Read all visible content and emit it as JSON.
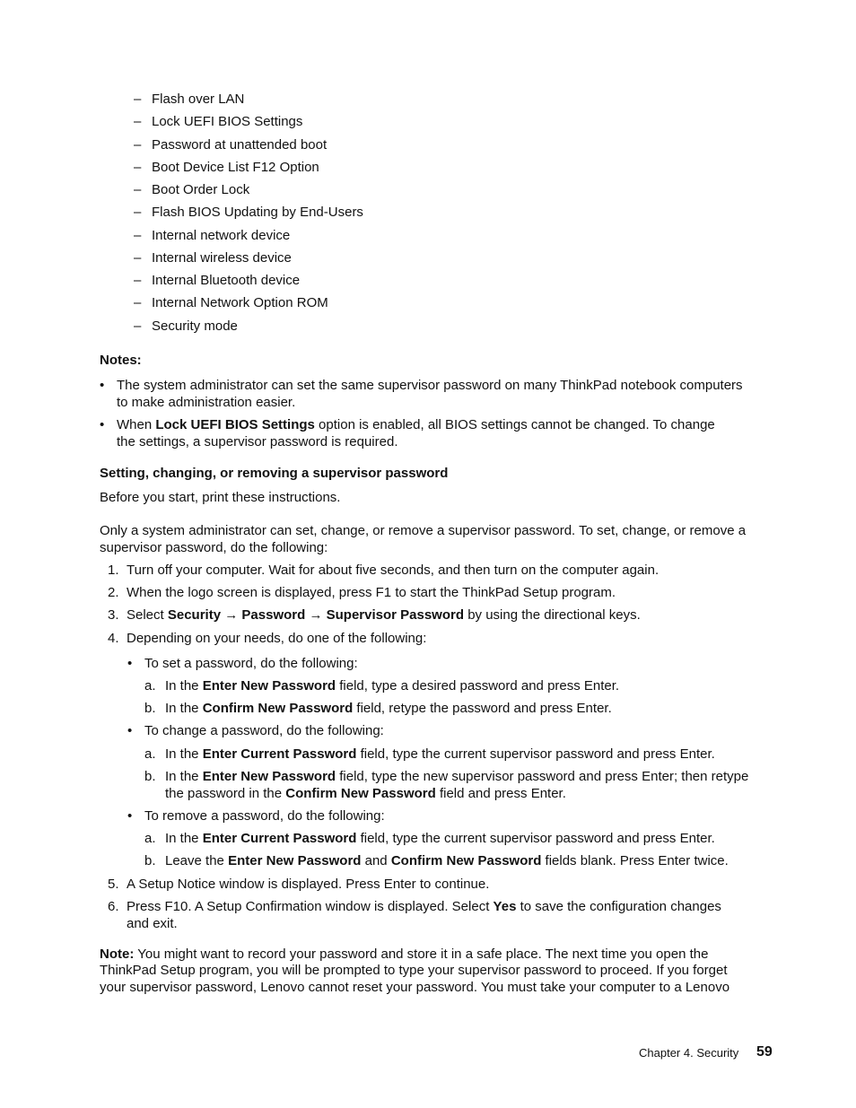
{
  "dash_list": [
    "Flash over LAN",
    "Lock UEFI BIOS Settings",
    "Password at unattended boot",
    "Boot Device List F12 Option",
    "Boot Order Lock",
    "Flash BIOS Updating by End-Users",
    "Internal network device",
    "Internal wireless device",
    "Internal Bluetooth device",
    "Internal Network Option ROM",
    "Security mode"
  ],
  "notes": {
    "heading": "Notes:",
    "item1_line1": "The system administrator can set the same supervisor password on many ThinkPad notebook computers",
    "item1_line2": "to make administration easier.",
    "item2_pre": "When ",
    "item2_bold": "Lock UEFI BIOS Settings",
    "item2_post": " option is enabled, all BIOS settings cannot be changed.  To change",
    "item2_line2": "the settings, a supervisor password is required."
  },
  "section": {
    "heading": "Setting, changing, or removing a supervisor password",
    "intro1": "Before you start, print these instructions.",
    "intro2_line1": "Only a system administrator can set, change, or remove a supervisor password.  To set, change, or remove a",
    "intro2_line2": "supervisor password, do the following:"
  },
  "steps": {
    "s1": "Turn off your computer.  Wait for about five seconds, and then turn on the computer again.",
    "s2": "When the logo screen is displayed, press F1 to start the ThinkPad Setup program.",
    "s3_pre": "Select ",
    "s3_b1": "Security",
    "s3_b2": "Password",
    "s3_b3": "Supervisor Password",
    "s3_post": " by using the directional keys.",
    "arrow": "→",
    "s4": "Depending on your needs, do one of the following:",
    "set_heading": "To set a password, do the following:",
    "set_a_pre": "In the ",
    "set_a_b": "Enter New Password",
    "set_a_post": " field, type a desired password and press Enter.",
    "set_b_pre": "In the ",
    "set_b_b": "Confirm New Password",
    "set_b_post": " field, retype the password and press Enter.",
    "change_heading": "To change a password, do the following:",
    "change_a_pre": "In the ",
    "change_a_b": "Enter Current Password",
    "change_a_post": " field, type the current supervisor password and press Enter.",
    "change_b_pre": "In the ",
    "change_b_b": "Enter New Password",
    "change_b_post": " field, type the new supervisor password and press Enter; then retype",
    "change_b_line2_pre": "the password in the ",
    "change_b_line2_b": "Confirm New Password",
    "change_b_line2_post": " field and press Enter.",
    "remove_heading": "To remove a password, do the following:",
    "remove_a_pre": "In the ",
    "remove_a_b": "Enter Current Password",
    "remove_a_post": " field, type the current supervisor password and press Enter.",
    "remove_b_pre": "Leave the ",
    "remove_b_b1": "Enter New Password",
    "remove_b_mid": " and ",
    "remove_b_b2": "Confirm New Password",
    "remove_b_post": " fields blank.  Press Enter twice.",
    "s5": "A Setup Notice window is displayed.  Press Enter to continue.",
    "s6_pre": "Press F10.  A Setup Confirmation window is displayed.  Select ",
    "s6_b": "Yes",
    "s6_post": " to save the configuration changes",
    "s6_line2": "and exit."
  },
  "note": {
    "label": "Note:",
    "line1": " You might want to record your password and store it in a safe place.  The next time you open the",
    "line2": "ThinkPad Setup program, you will be prompted to type your supervisor password to proceed.  If you forget",
    "line3": "your supervisor password, Lenovo cannot reset your password.  You must take your computer to a Lenovo"
  },
  "footer": {
    "chapter": "Chapter 4.  Security",
    "page": "59"
  },
  "markers": {
    "dash": "–",
    "bullet": "•",
    "n1": "1.",
    "n2": "2.",
    "n3": "3.",
    "n4": "4.",
    "n5": "5.",
    "n6": "6.",
    "a": "a.",
    "b": "b."
  }
}
